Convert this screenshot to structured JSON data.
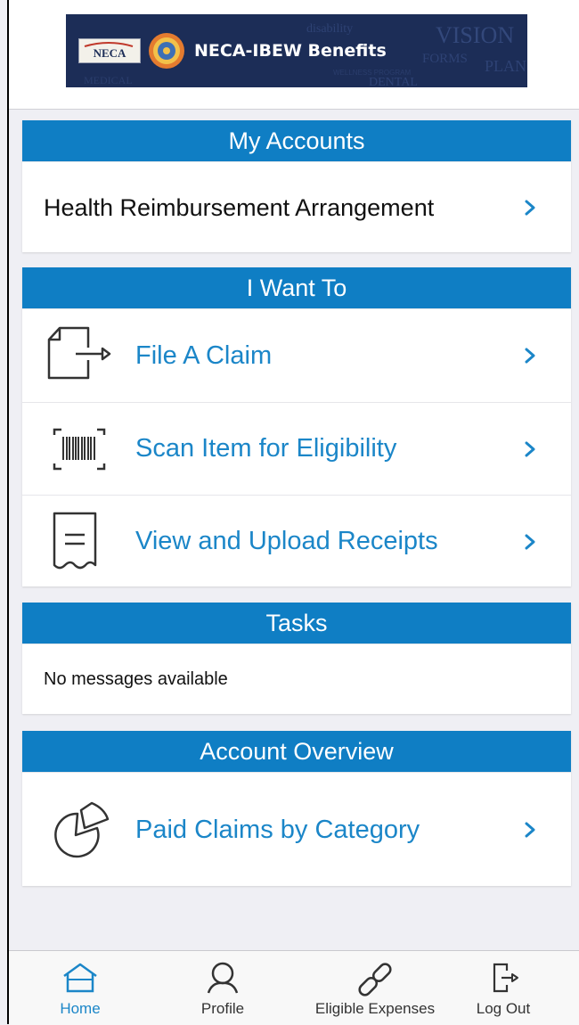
{
  "banner": {
    "neca_logo_text": "NECA",
    "title": "NECA-IBEW Benefits",
    "background_words": [
      "disability",
      "VISION",
      "FORMS",
      "PLAN",
      "DENTAL",
      "WELLNESS PROGRAM",
      "MEDICAL"
    ]
  },
  "my_accounts": {
    "header": "My Accounts",
    "items": [
      {
        "label": "Health Reimbursement Arrangement",
        "icon": "chevron-right-icon"
      }
    ]
  },
  "i_want_to": {
    "header": "I Want To",
    "items": [
      {
        "label": "File A Claim",
        "icon": "file-export-icon"
      },
      {
        "label": "Scan Item for Eligibility",
        "icon": "barcode-scan-icon"
      },
      {
        "label": "View and Upload Receipts",
        "icon": "receipt-icon"
      }
    ]
  },
  "tasks": {
    "header": "Tasks",
    "message": "No messages available"
  },
  "account_overview": {
    "header": "Account Overview",
    "items": [
      {
        "label": "Paid Claims by Category",
        "icon": "pie-chart-icon"
      }
    ]
  },
  "tab_bar": {
    "active": "Home",
    "tabs": [
      {
        "label": "Home",
        "icon": "home-icon"
      },
      {
        "label": "Profile",
        "icon": "user-icon"
      },
      {
        "label": "Eligible Expenses",
        "icon": "link-icon"
      },
      {
        "label": "Log Out",
        "icon": "logout-icon"
      }
    ]
  },
  "colors": {
    "accent": "#0f7ec4",
    "link": "#1b86c8",
    "banner_bg": "#1c2d57",
    "page_bg": "#efeff4",
    "inactive_tab": "#333333"
  }
}
